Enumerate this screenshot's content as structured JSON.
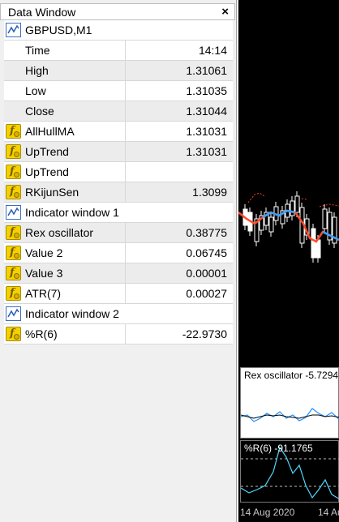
{
  "data_window": {
    "title": "Data Window",
    "close_symbol": "×",
    "rows": [
      {
        "type": "header",
        "icon": "chart-window-icon",
        "label": "GBPUSD,M1",
        "value": ""
      },
      {
        "type": "field",
        "icon": "",
        "label": "Time",
        "value": "14:14"
      },
      {
        "type": "field",
        "icon": "",
        "label": "High",
        "value": "1.31061"
      },
      {
        "type": "field",
        "icon": "",
        "label": "Low",
        "value": "1.31035"
      },
      {
        "type": "field",
        "icon": "",
        "label": "Close",
        "value": "1.31044"
      },
      {
        "type": "indicator",
        "icon": "indicator-f-icon",
        "label": "AllHullMA",
        "value": "1.31031"
      },
      {
        "type": "indicator",
        "icon": "indicator-f-icon",
        "label": "UpTrend",
        "value": "1.31031"
      },
      {
        "type": "indicator",
        "icon": "indicator-f-icon",
        "label": "UpTrend",
        "value": ""
      },
      {
        "type": "indicator",
        "icon": "indicator-f-icon",
        "label": "RKijunSen",
        "value": "1.3099"
      },
      {
        "type": "header",
        "icon": "chart-window-icon",
        "label": "Indicator window 1",
        "value": ""
      },
      {
        "type": "indicator",
        "icon": "indicator-f-icon",
        "label": "Rex oscillator",
        "value": "0.38775"
      },
      {
        "type": "indicator",
        "icon": "indicator-f-icon",
        "label": "Value 2",
        "value": "0.06745"
      },
      {
        "type": "indicator",
        "icon": "indicator-f-icon",
        "label": "Value 3",
        "value": "0.00001"
      },
      {
        "type": "indicator",
        "icon": "indicator-f-icon",
        "label": "ATR(7)",
        "value": "0.00027"
      },
      {
        "type": "header",
        "icon": "chart-window-icon",
        "label": "Indicator window 2",
        "value": ""
      },
      {
        "type": "indicator",
        "icon": "indicator-f-icon",
        "label": "%R(6)",
        "value": "-22.9730"
      }
    ]
  },
  "chart": {
    "subwindow1_label": "Rex oscillator -5.7294",
    "subwindow2_label": "%R(6) -91.1765",
    "date_labels": [
      "14 Aug 2020",
      "14 Au"
    ],
    "colors": {
      "background": "#000000",
      "hull_ma": "#ff4b2b",
      "uptrend": "#3aa0ff",
      "candle_up": "#ffffff",
      "oscillator": "#1e90ff"
    }
  }
}
